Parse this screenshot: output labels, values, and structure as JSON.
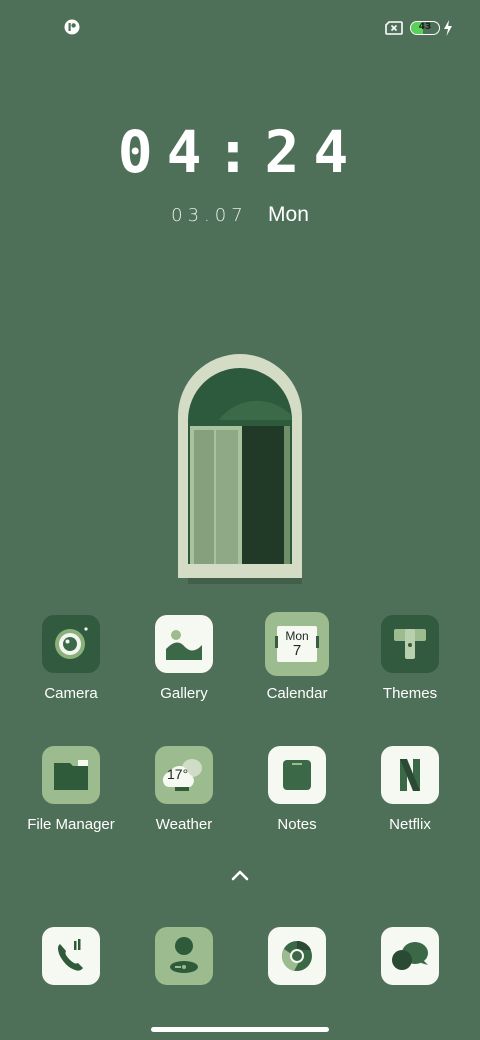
{
  "status_bar": {
    "battery_level": "43",
    "battery_fraction": 0.43,
    "icons": [
      "notification-icon",
      "no-sim-icon",
      "battery-icon",
      "charging-bolt-icon"
    ]
  },
  "lock": {
    "time": "04:24",
    "date": "03.07",
    "day": "Mon"
  },
  "calendar_widget": {
    "day": "Mon",
    "date": "7"
  },
  "weather_widget": {
    "temp": "17°"
  },
  "apps_row1": [
    {
      "label": "Camera",
      "icon": "camera-icon"
    },
    {
      "label": "Gallery",
      "icon": "gallery-icon"
    },
    {
      "label": "Calendar",
      "icon": "calendar-icon"
    },
    {
      "label": "Themes",
      "icon": "themes-icon"
    }
  ],
  "apps_row2": [
    {
      "label": "File Manager",
      "icon": "folder-icon"
    },
    {
      "label": "Weather",
      "icon": "weather-icon"
    },
    {
      "label": "Notes",
      "icon": "notes-icon"
    },
    {
      "label": "Netflix",
      "icon": "netflix-icon"
    }
  ],
  "dock": [
    {
      "icon": "phone-icon"
    },
    {
      "icon": "contacts-icon"
    },
    {
      "icon": "chrome-icon"
    },
    {
      "icon": "messages-icon"
    }
  ],
  "colors": {
    "background": "#4f7058",
    "dark_green": "#2f5b3b",
    "light_green": "#9cbb8f",
    "cream": "#f6f8f2"
  }
}
